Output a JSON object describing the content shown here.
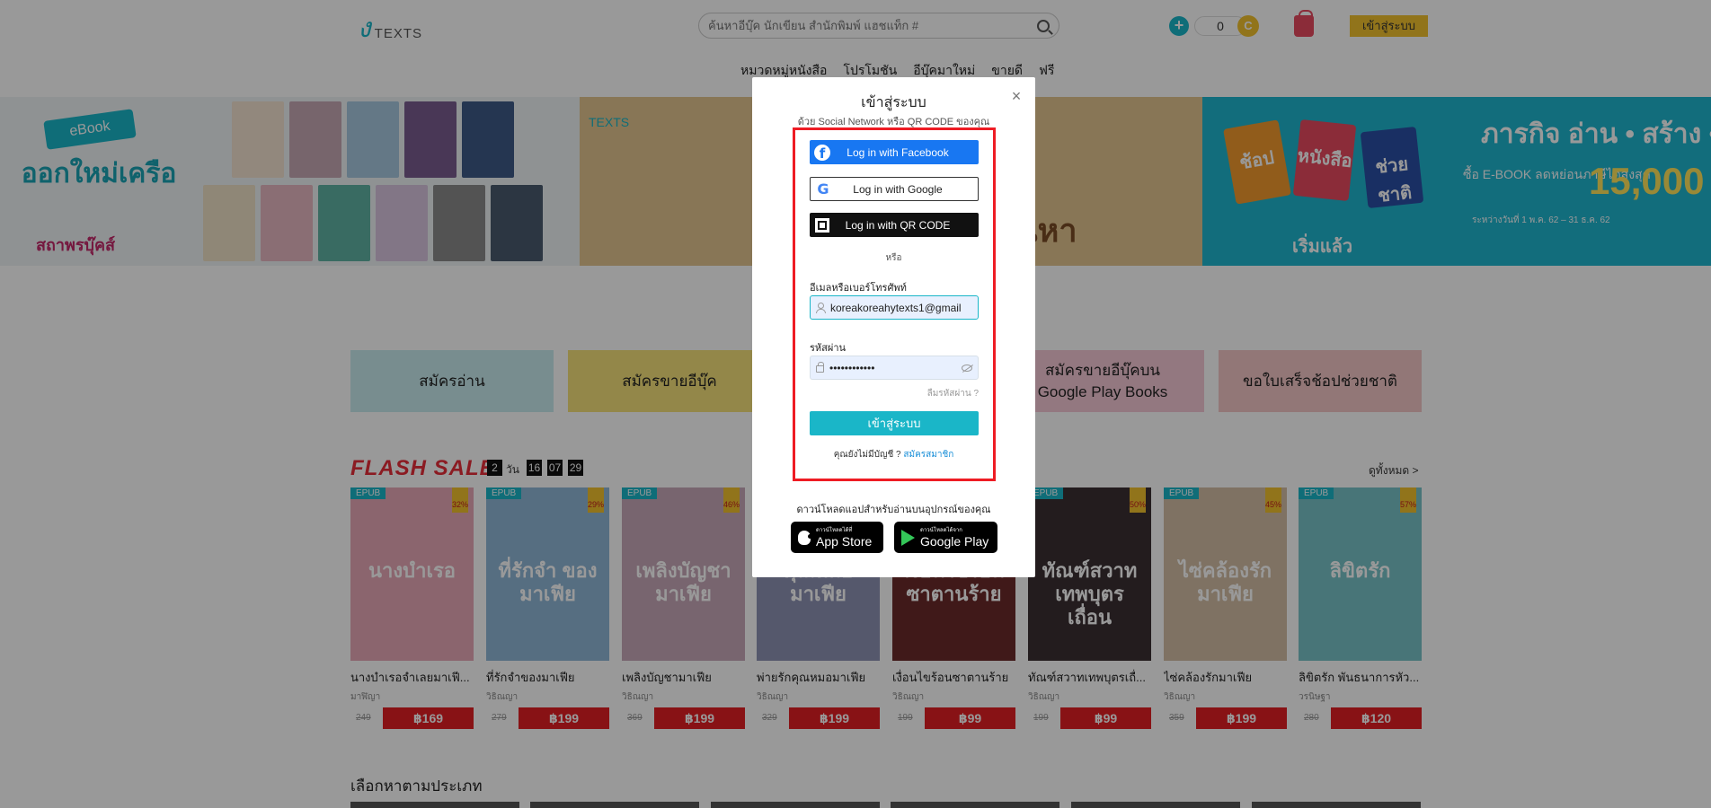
{
  "header": {
    "logo_text": "TEXTS",
    "search_placeholder": "ค้นหาอีบุ๊ค นักเขียน สำนักพิมพ์ แฮชแท็ก #",
    "coin_count": "0",
    "coin_symbol": "C",
    "login_label": "เข้าสู่ระบบ"
  },
  "nav": [
    "หมวดหมู่หนังสือ",
    "โปรโมชัน",
    "อีบุ๊คมาใหม่",
    "ขายดี",
    "ฟรี"
  ],
  "banners": {
    "a_tag": "eBook",
    "a_headline": "ออกใหม่เครือ",
    "a_publisher": "สถาพรบุ๊คส์",
    "b_logo": "TEXTS",
    "b_title": "น่หา",
    "c_headline": "ภารกิจ อ่าน • สร้าง •",
    "c_sub": "ซื้อ E-BOOK ลดหย่อนภาษีได้สูงสุด",
    "c_number": "15,000",
    "c_date": "ระหว่างวันที่ 1 พ.ค. 62 – 31 ธ.ค. 62",
    "c_start": "เริ่มแล้ว",
    "c_bags": [
      "ช้อป",
      "หนังสือ",
      "ช่วยชาติ"
    ]
  },
  "promos": [
    {
      "label": "สมัครอ่าน",
      "color": "#c9ecef"
    },
    {
      "label": "สมัครขายอีบุ๊ค",
      "color": "#f6e27a"
    },
    {
      "label": "สมัครขายอีบุ๊คบน\nGoogle Play Books",
      "color": "#f6c9d6"
    },
    {
      "label": "ขอใบเสร็จช้อปช่วยชาติ",
      "color": "#f4c7c7"
    }
  ],
  "flash": {
    "title": "FLASH SALE",
    "days": "2",
    "day_unit": "วัน",
    "hours": "16",
    "minutes": "07",
    "seconds": "29",
    "see_all": "ดูทั้งหมด >"
  },
  "books": [
    {
      "title": "นางบำเรอจำเลยมาเฟี...",
      "author": "มาฬิญา",
      "old": "249",
      "price": "฿169",
      "pct": "32%",
      "cover": "นางบำเรอ",
      "color": "#e8a9b8"
    },
    {
      "title": "ที่รักจำของมาเฟีย",
      "author": "วิธิณญา",
      "old": "279",
      "price": "฿199",
      "pct": "29%",
      "cover": "ที่รักจำ ของมาเฟีย",
      "color": "#8fb7d8"
    },
    {
      "title": "เพลิงบัญชามาเฟีย",
      "author": "วิธิณญา",
      "old": "369",
      "price": "฿199",
      "pct": "46%",
      "cover": "เพลิงบัญชา มาเฟีย",
      "color": "#c9a8b9"
    },
    {
      "title": "พ่ายรักคุณหมอมาเฟีย",
      "author": "วิธิณญา",
      "old": "329",
      "price": "฿199",
      "pct": "",
      "cover": "คุณหมอมาเฟีย",
      "color": "#8e93b5"
    },
    {
      "title": "เงื่อนไขร้อนซาตานร้าย",
      "author": "วิธิณญา",
      "old": "199",
      "price": "฿99",
      "pct": "",
      "cover": "เงื่อนไขร้อน ซาตานร้าย",
      "color": "#6b2a2a"
    },
    {
      "title": "ทัณฑ์สวาทเทพบุตรเถื่...",
      "author": "วิธิณญา",
      "old": "199",
      "price": "฿99",
      "pct": "50%",
      "cover": "ทัณฑ์สวาท เทพบุตรเถื่อน",
      "color": "#3b2f33"
    },
    {
      "title": "ไซ่คล้องรักมาเฟีย",
      "author": "วิธิณญา",
      "old": "359",
      "price": "฿199",
      "pct": "45%",
      "cover": "ไซ่คล้องรัก มาเฟีย",
      "color": "#d4bfa6"
    },
    {
      "title": "ลิขิตรัก พันธนาการหัว...",
      "author": "วรนิษฐา",
      "old": "280",
      "price": "฿120",
      "pct": "57%",
      "cover": "ลิขิตรัก",
      "color": "#79c4c9"
    }
  ],
  "category_title": "เลือกหาตามประเภท",
  "modal": {
    "title": "เข้าสู่ระบบ",
    "subtitle": "ด้วย Social Network หรือ QR CODE ของคุณ",
    "close": "×",
    "facebook_label": "Log in with Facebook",
    "google_label": "Log in with Google",
    "qr_label": "Log in with QR CODE",
    "or": "หรือ",
    "email_label": "อีเมลหรือเบอร์โทรศัพท์",
    "email_value": "koreakoreahytexts1@gmail",
    "password_label": "รหัสผ่าน",
    "password_value": "••••••••••••",
    "forgot": "ลืมรหัสผ่าน ?",
    "submit": "เข้าสู่ระบบ",
    "no_account": "คุณยังไม่มีบัญชี ?",
    "register": "สมัครสมาชิก",
    "download_text": "ดาวน์โหลดแอปสำหรับอ่านบนอุปกรณ์ของคุณ",
    "appstore_small": "ดาวน์โหลดได้ที่",
    "appstore_big": "App Store",
    "googleplay_small": "ดาวน์โหลดได้จาก",
    "googleplay_big": "Google Play"
  },
  "colors": {
    "accent": "#1ab6c8",
    "sale_red": "#e31e24",
    "highlight": "#ee1c24",
    "facebook": "#1877f2"
  }
}
